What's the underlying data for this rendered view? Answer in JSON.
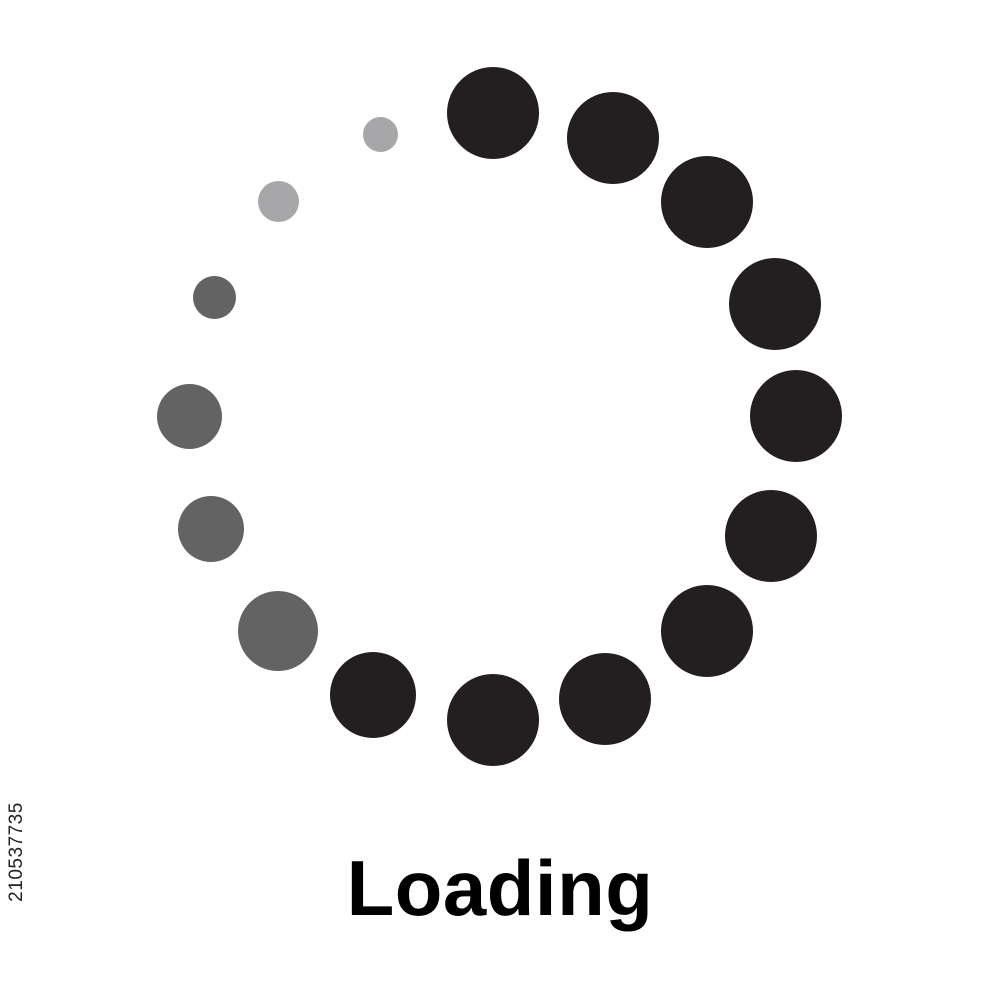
{
  "caption": "Loading",
  "stock_id": "210537735",
  "colors": {
    "primary_dot": "#231f20",
    "secondary_dot": "#636363",
    "fading_dot": "#a7a7a9",
    "text": "#000000"
  },
  "spinner": {
    "icon": "loading-spinner-icon",
    "dot_count": 16
  }
}
